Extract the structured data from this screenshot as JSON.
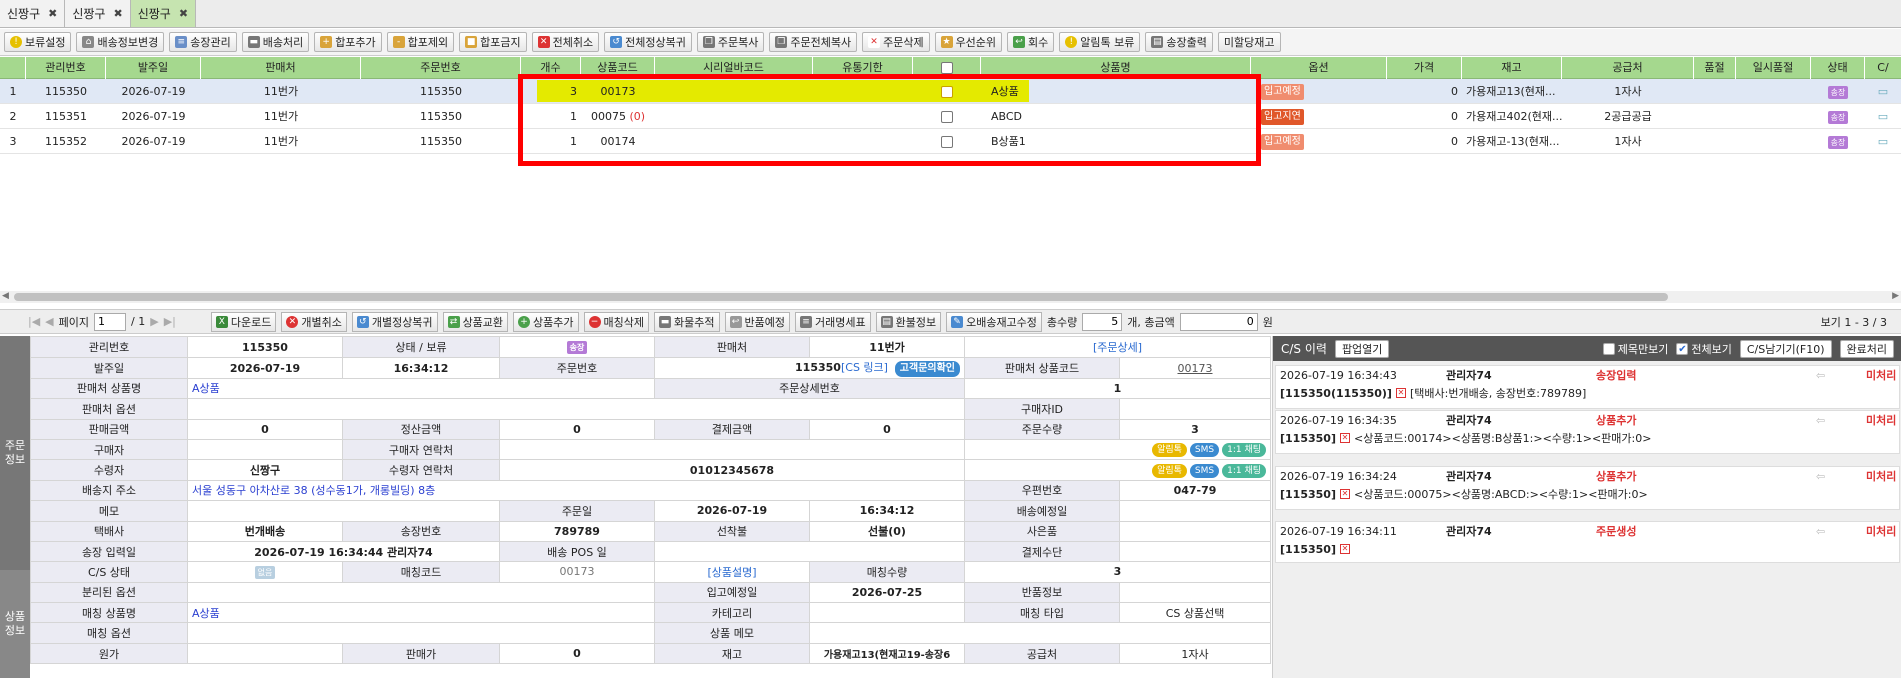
{
  "tabs": [
    "신짱구",
    "신짱구",
    "신짱구"
  ],
  "toolbar": [
    "보류설정",
    "배송정보변경",
    "송장관리",
    "배송처리",
    "합포추가",
    "합포제외",
    "합포금지",
    "전체취소",
    "전체정상복귀",
    "주문복사",
    "주문전체복사",
    "주문삭제",
    "우선순위",
    "회수",
    "알림톡 보류",
    "송장출력",
    "미할당재고"
  ],
  "colors": {
    "grid_header": "#a5d88e",
    "highlight": "#e4ea00",
    "red_box": "#ff0000",
    "status_badge": "#b47ad6"
  },
  "grid": {
    "headers": [
      "관리번호",
      "발주일",
      "판매처",
      "주문번호",
      "개수",
      "상품코드",
      "시리얼바코드",
      "유통기한",
      "",
      "상품명",
      "옵션",
      "가격",
      "재고",
      "공급처",
      "품절",
      "일시품절",
      "상태",
      "C/"
    ],
    "rows": [
      {
        "idx": "1",
        "no": "115350",
        "date": "2026-07-19",
        "shop": "11번가",
        "order": "115350",
        "qty": "3",
        "code": "00173",
        "code_extra": "",
        "name": "A상품",
        "badge": "입고예정",
        "badge_color": "#f08c6e",
        "price": "0",
        "stock": "가용재고13(현재...",
        "supplier": "1자사",
        "status": "송장"
      },
      {
        "idx": "2",
        "no": "115351",
        "date": "2026-07-19",
        "shop": "11번가",
        "order": "115350",
        "qty": "1",
        "code": "00075",
        "code_extra": "(0)",
        "name": "ABCD",
        "badge": "입고지연",
        "badge_color": "#e0572a",
        "price": "0",
        "stock": "가용재고402(현재...",
        "supplier": "2공급공급",
        "status": "송장"
      },
      {
        "idx": "3",
        "no": "115352",
        "date": "2026-07-19",
        "shop": "11번가",
        "order": "115350",
        "qty": "1",
        "code": "00174",
        "code_extra": "",
        "name": "B상품1",
        "badge": "입고예정",
        "badge_color": "#f08c6e",
        "price": "0",
        "stock": "가용재고-13(현재...",
        "supplier": "1자사",
        "status": "송장"
      }
    ]
  },
  "pager": {
    "page_label": "페이지",
    "page": "1",
    "total": "/ 1",
    "buttons": [
      "다운로드",
      "개별취소",
      "개별정상복귀",
      "상품교환",
      "상품추가",
      "매칭삭제",
      "화물추적",
      "반품예정",
      "거래명세표",
      "환불정보",
      "오배송재고수정"
    ],
    "total_qty_label": "총수량",
    "total_qty": "5",
    "total_amt_label": "개, 총금액",
    "total_amt": "0",
    "won": "원",
    "view": "보기 1 - 3 / 3"
  },
  "order_info": {
    "side": "주문\n정보",
    "mgmt_label": "관리번호",
    "mgmt": "115350",
    "status_label": "상태 / 보류",
    "status": "송장",
    "shop_label": "판매처",
    "shop": "11번가",
    "detail_link": "[주문상세]",
    "order_date_label": "발주일",
    "order_date": "2026-07-19",
    "order_time": "16:34:12",
    "order_no_label": "주문번호",
    "order_no": "115350",
    "cs_link": "[CS 링크]",
    "customer_btn": "고객문의확인",
    "shop_code_label": "판매처 상품코드",
    "shop_code": "00173",
    "shop_name_label": "판매처 상품명",
    "shop_name": "A상품",
    "detail_no_label": "주문상세번호",
    "detail_no": "1",
    "shop_option_label": "판매처 옵션",
    "buyer_id_label": "구매자ID",
    "sale_amt_label": "판매금액",
    "sale_amt": "0",
    "settle_label": "정산금액",
    "settle": "0",
    "pay_label": "결제금액",
    "pay": "0",
    "order_qty_label": "주문수량",
    "order_qty": "3",
    "buyer_label": "구매자",
    "buyer_contact_label": "구매자 연락처",
    "receiver_label": "수령자",
    "receiver": "신짱구",
    "receiver_contact_label": "수령자 연락처",
    "receiver_contact": "01012345678",
    "pill_alarm": "알림톡",
    "pill_sms": "SMS",
    "pill_chat": "1:1 채팅",
    "address_label": "배송지 주소",
    "address": "서울 성동구 아차산로 38 (성수동1가, 개롱빌딩) 8층",
    "zip_label": "우편번호",
    "zip": "047-79",
    "memo_label": "메모",
    "order_day_label": "주문일",
    "order_day": "2026-07-19",
    "order_day_time": "16:34:12",
    "ship_plan_label": "배송예정일",
    "courier_label": "택배사",
    "courier": "번개배송",
    "invoice_label": "송장번호",
    "invoice": "789789",
    "prepay_label": "선착불",
    "prepay": "선불(0)",
    "gift_label": "사은품",
    "invoice_date_label": "송장 입력일",
    "invoice_date": "2026-07-19 16:34:44 관리자74",
    "pos_label": "배송 POS 일",
    "pay_method_label": "결제수단"
  },
  "product_info": {
    "side": "상품\n정보",
    "cs_label": "C/S 상태",
    "cs_val": "없음",
    "match_code_label": "매칭코드",
    "match_code": "00173",
    "desc_link": "[상품설명]",
    "match_qty_label": "매칭수량",
    "match_qty": "3",
    "split_label": "분리된 옵션",
    "arrival_label": "입고예정일",
    "arrival": "2026-07-25",
    "return_label": "반품정보",
    "match_name_label": "매칭 상품명",
    "match_name": "A상품",
    "category_label": "카테고리",
    "match_type_label": "매칭 타입",
    "match_type": "CS 상품선택",
    "match_option_label": "매칭 옵션",
    "product_memo_label": "상품 메모",
    "cost_label": "원가",
    "price_label": "판매가",
    "price": "0",
    "stock_label": "재고",
    "stock": "가용재고13(현재고19-송장6",
    "supplier_label": "공급처",
    "supplier": "1자사"
  },
  "cs": {
    "title": "C/S 이력",
    "popup": "팝업열기",
    "subject_only": "제목만보기",
    "view_all": "전체보기",
    "cs_btn": "C/S남기기(F10)",
    "done_btn": "완료처리",
    "items": [
      {
        "time": "2026-07-19 16:34:43",
        "user": "관리자74",
        "type": "송장입력",
        "state": "미처리",
        "id": "[115350(115350)]",
        "text": "[택배사:번개배송, 송장번호:789789]"
      },
      {
        "time": "2026-07-19 16:34:35",
        "user": "관리자74",
        "type": "상품추가",
        "state": "미처리",
        "id": "[115350]",
        "text": "<상품코드:00174><상품명:B상품1:><수량:1><판매가:0>"
      },
      {
        "time": "2026-07-19 16:34:24",
        "user": "관리자74",
        "type": "상품추가",
        "state": "미처리",
        "id": "[115350]",
        "text": "<상품코드:00075><상품명:ABCD:><수량:1><판매가:0>"
      },
      {
        "time": "2026-07-19 16:34:11",
        "user": "관리자74",
        "type": "주문생성",
        "state": "미처리",
        "id": "[115350]",
        "text": ""
      }
    ]
  }
}
